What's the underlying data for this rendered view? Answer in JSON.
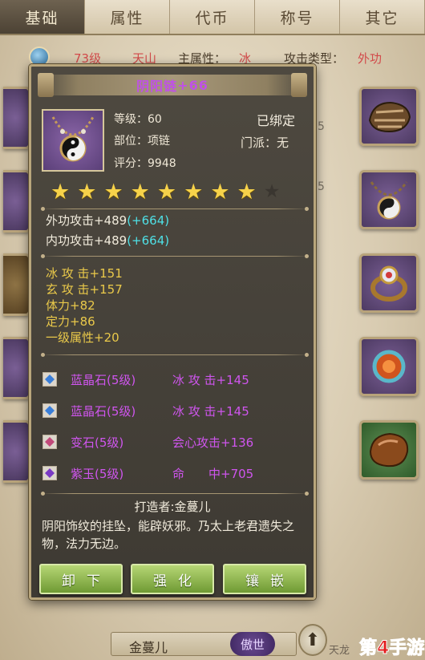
{
  "tabs": [
    "基础",
    "属性",
    "代币",
    "称号",
    "其它"
  ],
  "active_tab": 0,
  "bg_info": {
    "level": "73级",
    "sect": "天山",
    "main_attr_label": "主属性：",
    "main_attr_value": "冰",
    "attack_type_label": "攻击类型：",
    "attack_type_value": "外功"
  },
  "side_numbers": [
    "5",
    "5"
  ],
  "item": {
    "name": "阴阳链",
    "enhance": "+66",
    "name_color": "#c050e8",
    "level_label": "等级：",
    "level_value": "60",
    "slot_label": "部位：",
    "slot_value": "项链",
    "score_label": "评分：",
    "score_value": "9948",
    "bound": "已绑定",
    "sect_label": "门派：",
    "sect_value": "无",
    "stars_filled": 8,
    "stars_total": 9
  },
  "base_attrs": [
    {
      "label": "外功攻击+489",
      "bonus": "(+664)"
    },
    {
      "label": "内功攻击+489",
      "bonus": "(+664)"
    }
  ],
  "extra_attrs": [
    "冰 攻 击+151",
    "玄 攻 击+157",
    "体力+82",
    "定力+86",
    "一级属性+20"
  ],
  "gems": [
    {
      "name": "蓝晶石(5级)",
      "effect": "冰 攻 击+145",
      "icon": "blue-crystal-icon"
    },
    {
      "name": "蓝晶石(5级)",
      "effect": "冰 攻 击+145",
      "icon": "blue-crystal-icon"
    },
    {
      "name": "变石(5级)",
      "effect": "会心攻击+136",
      "icon": "alexandrite-icon"
    },
    {
      "name": "紫玉(5级)",
      "effect": "命　　中+705",
      "icon": "purple-jade-icon"
    }
  ],
  "maker": "打造者:金蔓儿",
  "description": "阴阳饰纹的挂坠，能辟妖邪。乃太上老君遗失之物，法力无边。",
  "buttons": [
    "卸下",
    "强化",
    "镶嵌"
  ],
  "bottom": {
    "name": "金蔓儿",
    "title": "傲世",
    "arrow": "⬆"
  },
  "watermark": {
    "small": "天龙",
    "brand": "第4手游"
  }
}
